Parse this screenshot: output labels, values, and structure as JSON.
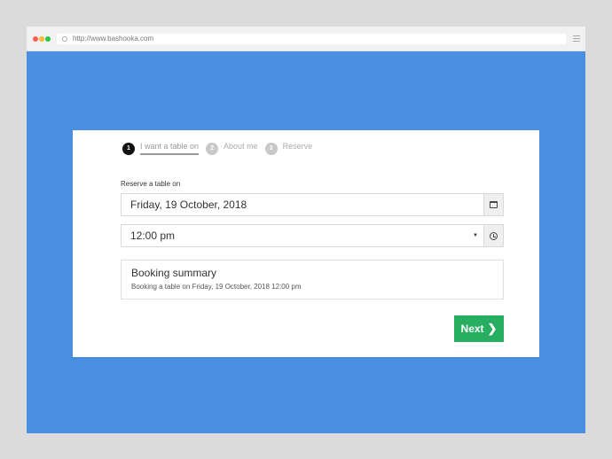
{
  "browser": {
    "url": "http://www.bashooka.com"
  },
  "steps": [
    {
      "number": "1",
      "label": "I want a table on",
      "active": true
    },
    {
      "number": "2",
      "label": "About me",
      "active": false
    },
    {
      "number": "3",
      "label": "Reserve",
      "active": false
    }
  ],
  "form": {
    "reserve_label": "Reserve a table on",
    "date_value": "Friday, 19 October, 2018",
    "time_value": "12:00 pm"
  },
  "summary": {
    "title": "Booking summary",
    "text": "Booking a table on Friday, 19 October, 2018 12:00 pm"
  },
  "actions": {
    "next_label": "Next",
    "next_icon": "chevron-right-icon",
    "next_color": "#27ae60"
  },
  "colors": {
    "page_bg": "#4a90e2",
    "card_bg": "#ffffff"
  }
}
